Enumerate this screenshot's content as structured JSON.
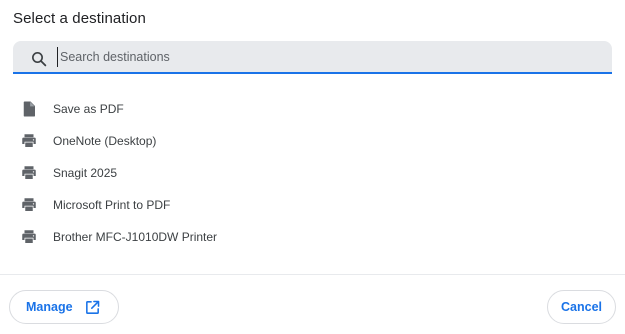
{
  "dialog": {
    "title": "Select a destination"
  },
  "search": {
    "placeholder": "Search destinations",
    "value": "",
    "icon": "search-icon"
  },
  "destinations": [
    {
      "label": "Save as PDF",
      "icon": "file-icon"
    },
    {
      "label": "OneNote (Desktop)",
      "icon": "printer-icon"
    },
    {
      "label": "Snagit 2025",
      "icon": "printer-icon"
    },
    {
      "label": "Microsoft Print to PDF",
      "icon": "printer-icon"
    },
    {
      "label": "Brother MFC-J1010DW Printer",
      "icon": "printer-icon"
    }
  ],
  "footer": {
    "manage_label": "Manage",
    "manage_icon": "external-link-icon",
    "cancel_label": "Cancel"
  },
  "colors": {
    "accent": "#1a73e8",
    "search_bg": "#e8eaed",
    "icon_gray": "#5f6368"
  }
}
